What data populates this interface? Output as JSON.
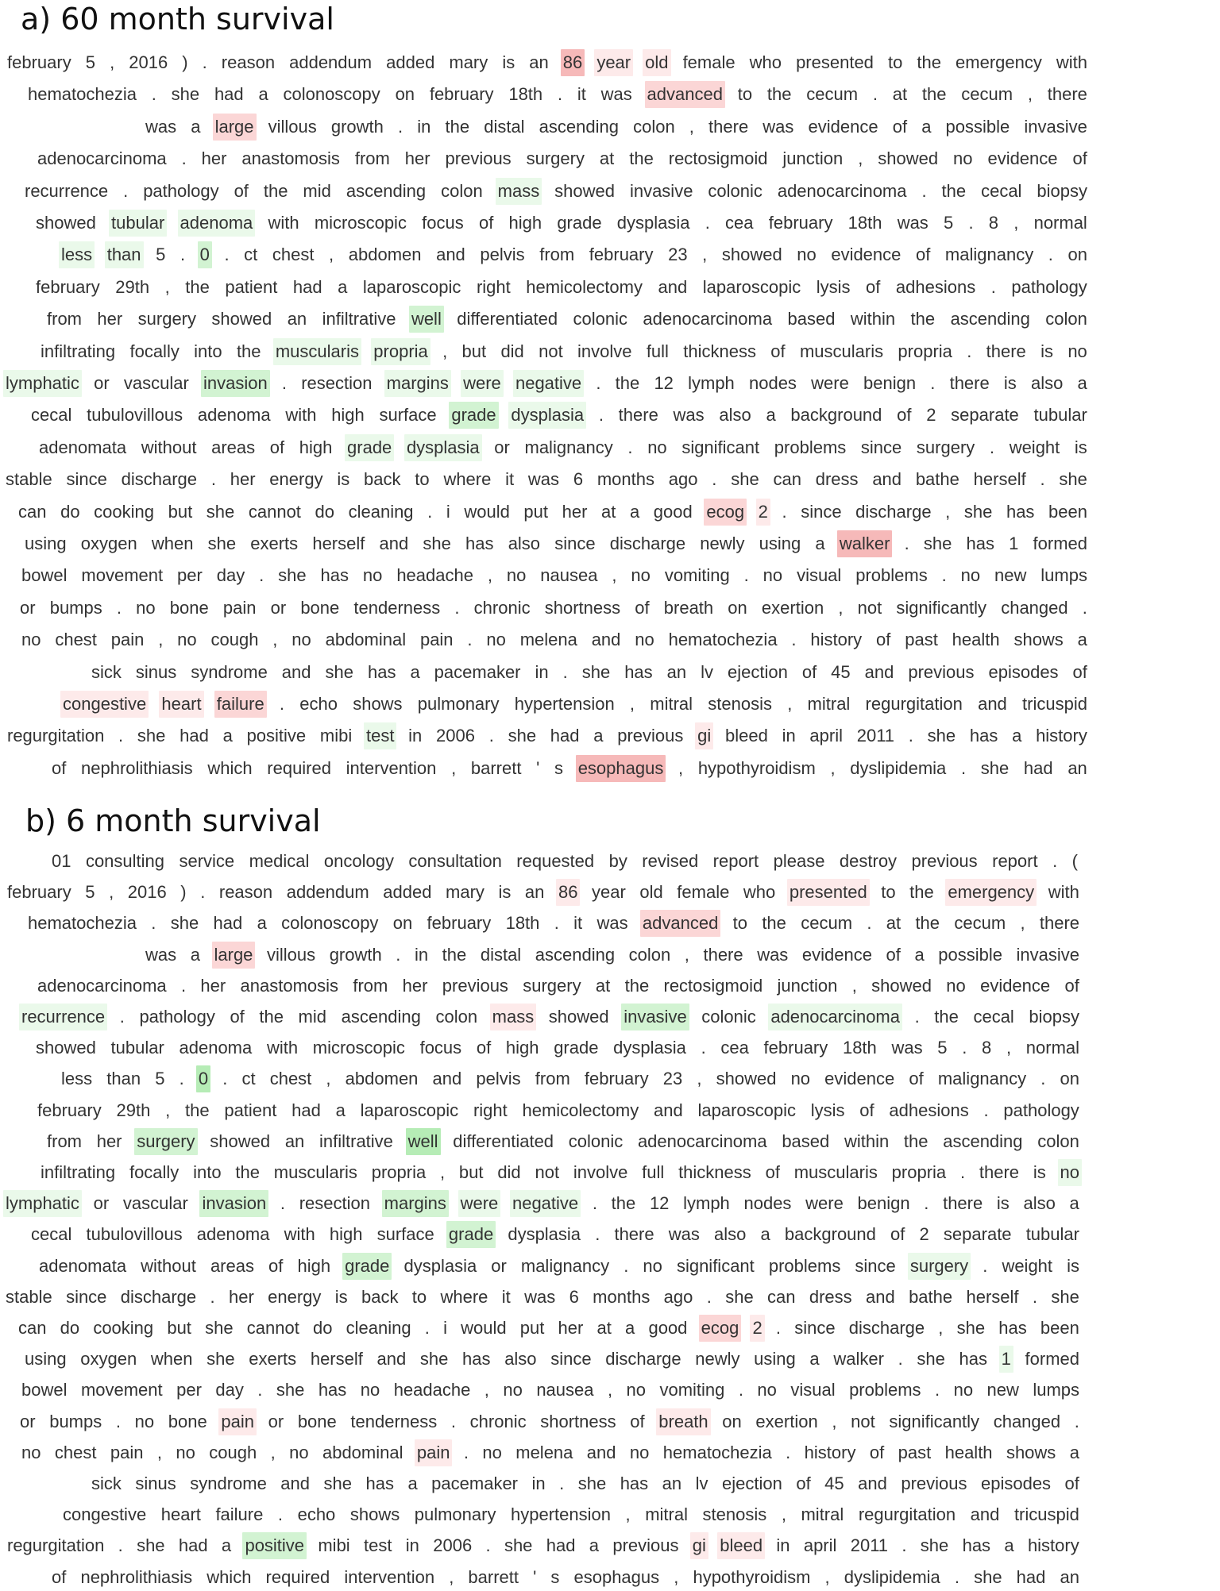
{
  "panels": [
    {
      "title": "a) 60 month survival",
      "lines": [
        "february 5 , 2016 ) . reason addendum added mary is an [86|r3] [year|r1] [old|r1] female who presented to the emergency with",
        "hematochezia . she had a colonoscopy on february 18th . it was [advanced|r2] to the cecum . at the cecum , there",
        "was a [large|r2] villous growth . in the distal ascending colon , there was evidence of a possible invasive",
        "adenocarcinoma . her anastomosis from her previous surgery at the rectosigmoid junction , showed no evidence of",
        "recurrence . pathology of the mid ascending colon [mass|g1] showed invasive colonic adenocarcinoma . the cecal biopsy",
        "showed [tubular|g1] [adenoma|g1] with microscopic focus of high grade dysplasia . cea february 18th was 5 . 8 , normal",
        "[less|g1] [than|g1] 5 . [0|g2] . ct chest , abdomen and pelvis from february 23 , showed no evidence of malignancy . on",
        "february 29th , the patient had a laparoscopic right hemicolectomy and laparoscopic lysis of adhesions . pathology",
        "from her surgery showed an infiltrative [well|g2] differentiated colonic adenocarcinoma based within the ascending colon",
        "infiltrating focally into the [muscularis|g1] [propria|g1] , but did not involve full thickness of muscularis propria . there is no",
        "[lymphatic|g1] or vascular [invasion|g2] . resection [margins|g1] [were|g1] [negative|g1] . the 12 lymph nodes were benign . there is also a",
        "cecal tubulovillous adenoma with high surface [grade|g2] [dysplasia|g1] . there was also a background of 2 separate tubular",
        "adenomata without areas of high [grade|g1] [dysplasia|g1] or malignancy . no significant problems since surgery . weight is",
        "stable since discharge . her energy is back to where it was 6 months ago . she can dress and bathe herself . she",
        "can do cooking but she cannot do cleaning . i would put her at a good [ecog|r2] [2|r1] . since discharge , she has been",
        "using oxygen when she exerts herself and she has also since discharge newly using a [walker|r3] . she has 1 formed",
        "bowel movement per day . she has no headache , no nausea , no vomiting . no visual problems . no new lumps",
        "or bumps . no bone pain or bone tenderness . chronic shortness of breath on exertion , not significantly changed .",
        "no chest pain , no cough , no abdominal pain . no melena and no hematochezia . history of past health shows a",
        "sick sinus syndrome and she has a pacemaker in . she has an lv ejection of 45 and previous episodes of",
        "[congestive|r1] [heart|r1] [failure|r2] . echo shows pulmonary hypertension , mitral stenosis , mitral regurgitation and tricuspid",
        "regurgitation . she had a positive mibi [test|g1] in 2006 . she had a previous [gi|r1] bleed in april 2011 . she has a history",
        "of nephrolithiasis which required intervention , barrett ' s [esophagus|r3] , hypothyroidism , dyslipidemia . she had an"
      ]
    },
    {
      "title": "b) 6 month survival",
      "lines": [
        "01 consulting service medical oncology consultation requested by revised report please destroy previous report . (",
        "february 5 , 2016 ) . reason addendum added mary is an [86|r1] year old female who [presented|r1] to the [emergency|r1] with",
        "hematochezia . she had a colonoscopy on february 18th . it was [advanced|r2] to the cecum . at the cecum , there",
        "was a [large|r2] villous growth . in the distal ascending colon , there was evidence of a possible invasive",
        "adenocarcinoma . her anastomosis from her previous surgery at the rectosigmoid junction , showed no evidence of",
        "[recurrence|g1] . pathology of the mid ascending colon [mass|r1] showed [invasive|g2] colonic [adenocarcinoma|g1] . the cecal biopsy",
        "showed tubular adenoma with microscopic focus of high grade dysplasia . cea february 18th was 5 . 8 , normal",
        "less than 5 . [0|g3] . ct chest , abdomen and pelvis from february 23 , showed no evidence of malignancy . on",
        "february 29th , the patient had a laparoscopic right hemicolectomy and laparoscopic lysis of adhesions . pathology",
        "from her [surgery|g2] showed an infiltrative [well|g3] differentiated colonic adenocarcinoma based within the ascending colon",
        "infiltrating focally into the muscularis propria , but did not involve full thickness of muscularis propria . there is [no|g1]",
        "[lymphatic|g1] or vascular [invasion|g2] . resection [margins|g2] [were|g1] [negative|g1] . the 12 lymph nodes were benign . there is also a",
        "cecal tubulovillous adenoma with high surface [grade|g2] dysplasia . there was also a background of 2 separate tubular",
        "adenomata without areas of high [grade|g2] dysplasia or malignancy . no significant problems since [surgery|g1] . weight is",
        "stable since discharge . her energy is back to where it was 6 months ago . she can dress and bathe herself . she",
        "can do cooking but she cannot do cleaning . i would put her at a good [ecog|r2] [2|r1] . since discharge , she has been",
        "using oxygen when she exerts herself and she has also since discharge newly using a walker . she has [1|g1] formed",
        "bowel movement per day . she has no headache , no nausea , no vomiting . no visual problems . no new lumps",
        "or bumps . no bone [pain|r1] or bone tenderness . chronic shortness of [breath|r1] on exertion , not significantly changed .",
        "no chest pain , no cough , no abdominal [pain|r1] . no melena and no hematochezia . history of past health shows a",
        "sick sinus syndrome and she has a pacemaker in . she has an lv ejection of 45 and previous episodes of",
        "congestive heart failure . echo shows pulmonary hypertension , mitral stenosis , mitral regurgitation and tricuspid",
        "regurgitation . she had a [positive|g2] mibi test in 2006 . she had a previous [gi|r1] [bleed|r1] in april 2011 . she has a history",
        "of nephrolithiasis which required intervention , barrett ' s esophagus , hypothyroidism , dyslipidemia . she had an"
      ]
    }
  ],
  "highlight_colors": {
    "r1": "#fdeaea",
    "r2": "#fbd6d6",
    "r3": "#f6b9b9",
    "g1": "#eaf9ea",
    "g2": "#d2f3d2",
    "g3": "#b6ecb6"
  }
}
